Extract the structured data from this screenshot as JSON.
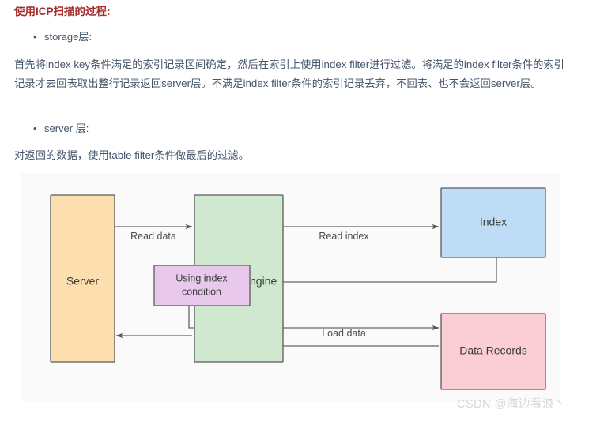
{
  "article": {
    "heading": "使用ICP扫描的过程:",
    "bullets": [
      {
        "marker": "•",
        "text": "storage层:"
      },
      {
        "marker": "•",
        "text": "server 层:"
      }
    ],
    "paragraphs": [
      "首先将index key条件满足的索引记录区间确定，然后在索引上使用index filter进行过滤。将满足的index filter条件的索引记录才去回表取出整行记录返回server层。不满足index filter条件的索引记录丢弃，不回表、也不会返回server层。",
      "对返回的数据，使用table filter条件做最后的过滤。"
    ],
    "heading_color": "#a62b2b",
    "body_color": "#44546a"
  },
  "diagram": {
    "background": "#fafafa",
    "nodes": [
      {
        "id": "server",
        "label": "Server",
        "fill": "#fddfaf",
        "stroke": "#5a5a5a"
      },
      {
        "id": "storage",
        "label": "Storage Engine",
        "fill": "#cfe8cf",
        "stroke": "#5a5a5a"
      },
      {
        "id": "index",
        "label": "Index",
        "fill": "#bedcf5",
        "stroke": "#5a5a5a"
      },
      {
        "id": "using-index",
        "label_line1": "Using index",
        "label_line2": "condition",
        "fill": "#e8c9ec",
        "stroke": "#5a5a5a"
      },
      {
        "id": "data-records",
        "label": "Data Records",
        "fill": "#fbcdd4",
        "stroke": "#5a5a5a"
      }
    ],
    "edges": [
      {
        "id": "read-data",
        "label": "Read data",
        "from": "server",
        "to": "storage"
      },
      {
        "id": "read-index",
        "label": "Read index",
        "from": "storage",
        "to": "index"
      },
      {
        "id": "index-to-uic",
        "label": "",
        "from": "index",
        "to": "using-index"
      },
      {
        "id": "uic-to-data",
        "label": "",
        "from": "using-index",
        "to": "data-records"
      },
      {
        "id": "load-data",
        "label": "Load data",
        "from": "data-records",
        "to": "storage"
      },
      {
        "id": "return-data",
        "label": "",
        "from": "storage",
        "to": "server"
      }
    ]
  },
  "watermark": {
    "text": "CSDN @海边看浪丶",
    "color": "#d6d6d6"
  }
}
